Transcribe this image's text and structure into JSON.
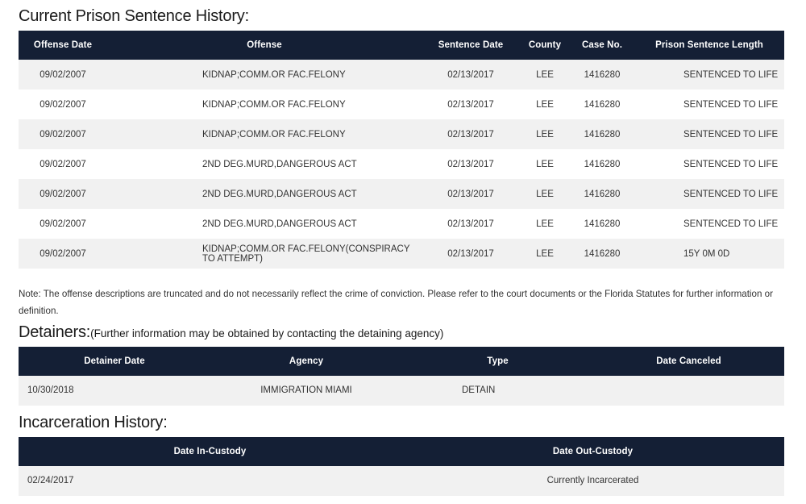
{
  "sections": {
    "prison_sentence": {
      "heading": "Current Prison Sentence History:",
      "columns": {
        "offense_date": "Offense Date",
        "offense": "Offense",
        "sentence_date": "Sentence Date",
        "county": "County",
        "case_no": "Case No.",
        "prison_sentence_length": "Prison Sentence Length"
      },
      "rows": [
        {
          "offense_date": "09/02/2007",
          "offense": "KIDNAP;COMM.OR FAC.FELONY",
          "sentence_date": "02/13/2017",
          "county": "LEE",
          "case_no": "1416280",
          "prison_sentence_length": "SENTENCED TO LIFE"
        },
        {
          "offense_date": "09/02/2007",
          "offense": "KIDNAP;COMM.OR FAC.FELONY",
          "sentence_date": "02/13/2017",
          "county": "LEE",
          "case_no": "1416280",
          "prison_sentence_length": "SENTENCED TO LIFE"
        },
        {
          "offense_date": "09/02/2007",
          "offense": "KIDNAP;COMM.OR FAC.FELONY",
          "sentence_date": "02/13/2017",
          "county": "LEE",
          "case_no": "1416280",
          "prison_sentence_length": "SENTENCED TO LIFE"
        },
        {
          "offense_date": "09/02/2007",
          "offense": "2ND DEG.MURD,DANGEROUS ACT",
          "sentence_date": "02/13/2017",
          "county": "LEE",
          "case_no": "1416280",
          "prison_sentence_length": "SENTENCED TO LIFE"
        },
        {
          "offense_date": "09/02/2007",
          "offense": "2ND DEG.MURD,DANGEROUS ACT",
          "sentence_date": "02/13/2017",
          "county": "LEE",
          "case_no": "1416280",
          "prison_sentence_length": "SENTENCED TO LIFE"
        },
        {
          "offense_date": "09/02/2007",
          "offense": "2ND DEG.MURD,DANGEROUS ACT",
          "sentence_date": "02/13/2017",
          "county": "LEE",
          "case_no": "1416280",
          "prison_sentence_length": "SENTENCED TO LIFE"
        },
        {
          "offense_date": "09/02/2007",
          "offense": "KIDNAP;COMM.OR FAC.FELONY(CONSPIRACY TO ATTEMPT)",
          "sentence_date": "02/13/2017",
          "county": "LEE",
          "case_no": "1416280",
          "prison_sentence_length": "15Y 0M 0D"
        }
      ],
      "note": "Note: The offense descriptions are truncated and do not necessarily reflect the crime of conviction. Please refer to the court documents or the Florida Statutes for further information or definition."
    },
    "detainers": {
      "heading": "Detainers:",
      "heading_note": "(Further information may be obtained by contacting the detaining agency)",
      "columns": {
        "detainer_date": "Detainer Date",
        "agency": "Agency",
        "type": "Type",
        "date_canceled": "Date Canceled"
      },
      "rows": [
        {
          "detainer_date": "10/30/2018",
          "agency": "IMMIGRATION MIAMI",
          "type": "DETAIN",
          "date_canceled": ""
        }
      ]
    },
    "incarceration": {
      "heading": "Incarceration History:",
      "columns": {
        "date_in_custody": "Date In-Custody",
        "date_out_custody": "Date Out-Custody"
      },
      "rows": [
        {
          "date_in_custody": "02/24/2017",
          "date_out_custody": "Currently Incarcerated"
        }
      ]
    }
  },
  "colors": {
    "table_header_bg": "#141f35",
    "table_header_text": "#ffffff",
    "row_alt_bg": "#f1f1f1",
    "row_bg": "#ffffff",
    "body_text": "#333333",
    "heading_text": "#1a1a1a"
  }
}
